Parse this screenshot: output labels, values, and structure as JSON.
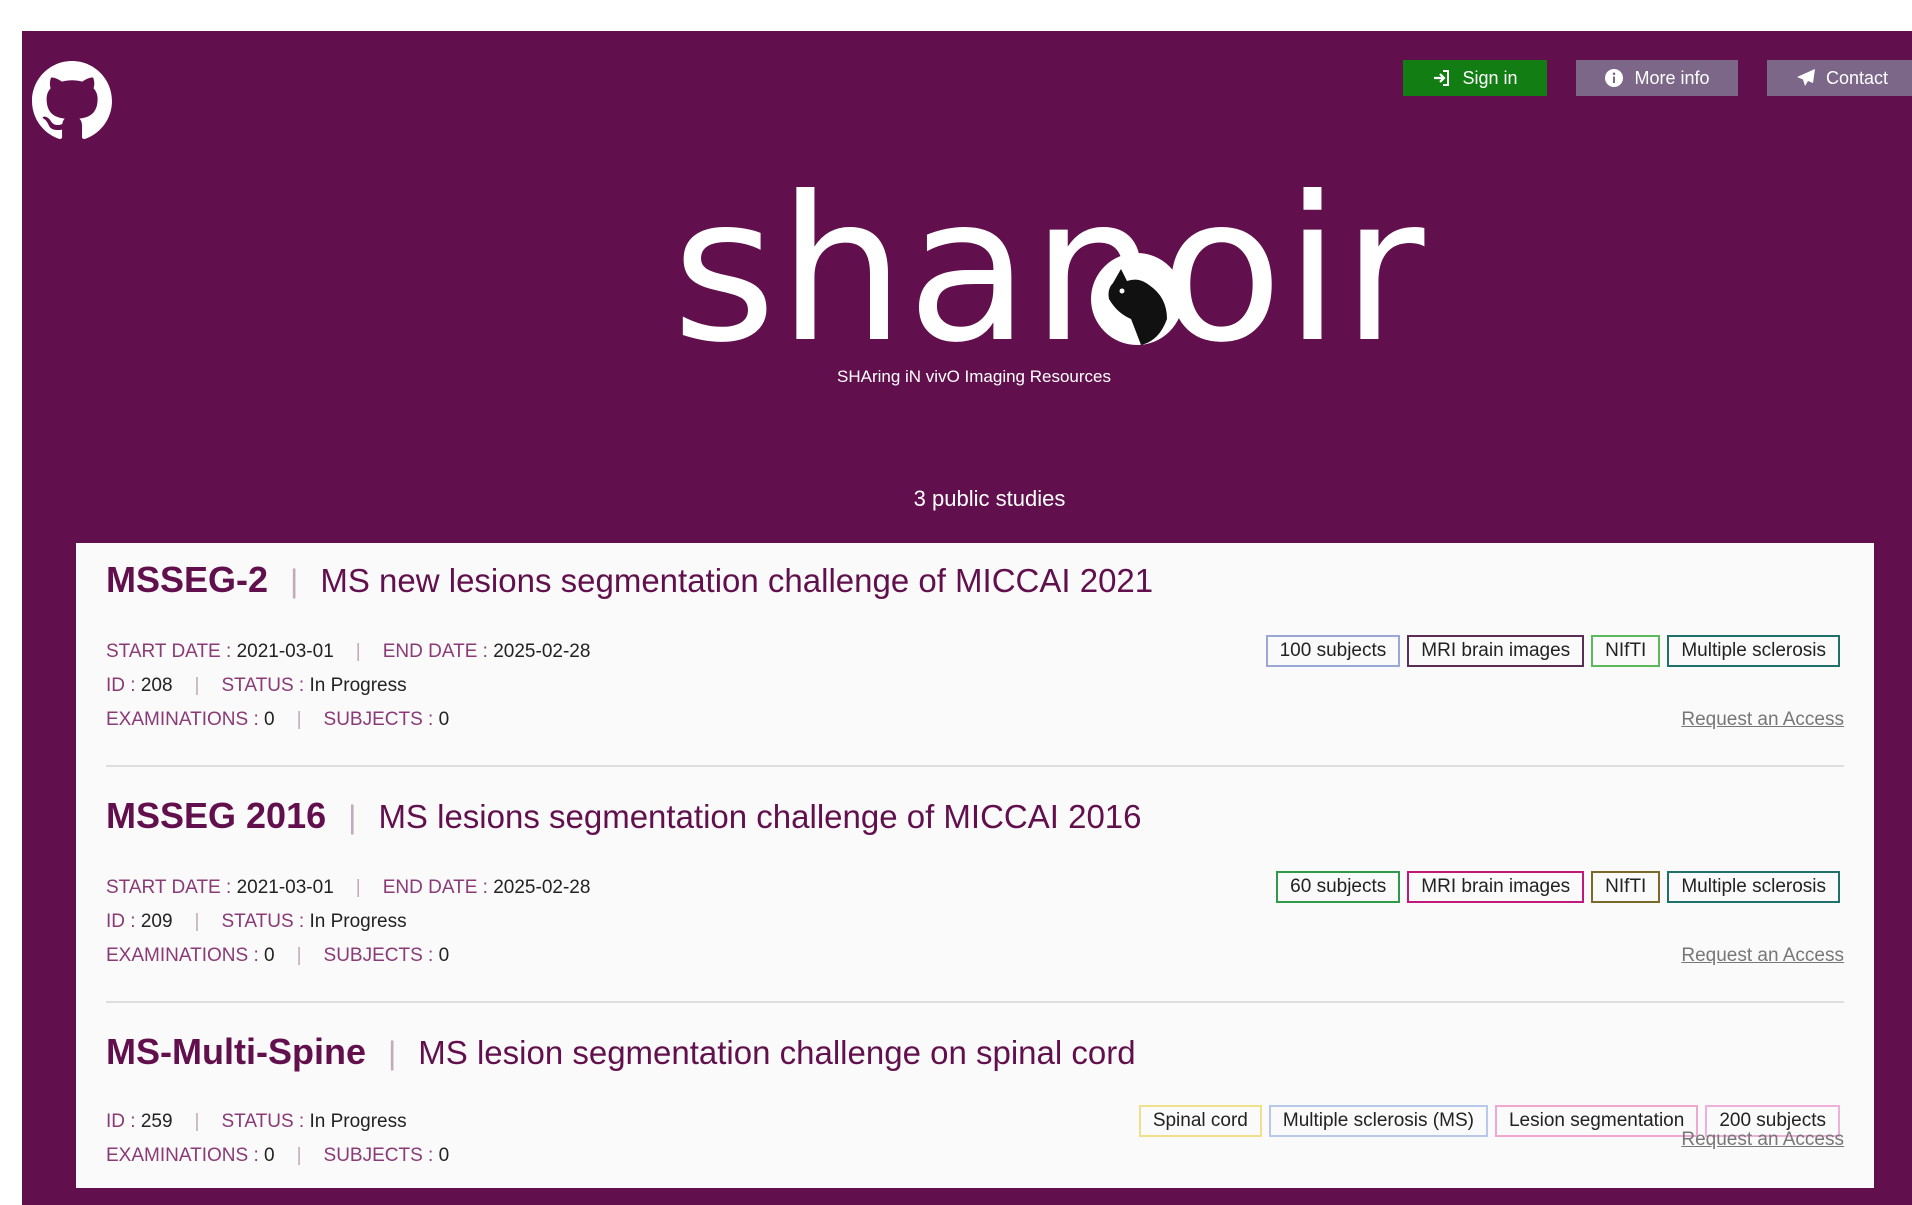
{
  "header": {
    "nav": {
      "sign_in": "Sign in",
      "more_info": "More info",
      "contact": "Contact"
    },
    "logo_text": "shanoir",
    "tagline": "SHAring iN vivO Imaging Resources",
    "study_count": "3 public studies"
  },
  "labels": {
    "start_date": "START DATE",
    "end_date": "END DATE",
    "id": "ID",
    "status": "STATUS",
    "examinations": "EXAMINATIONS",
    "subjects": "SUBJECTS",
    "request_access": "Request an Access"
  },
  "colors": {
    "brand_purple": "#62104d",
    "sign_in_green": "#117d12",
    "nav_gray": "#7c6789"
  },
  "studies": [
    {
      "code": "MSSEG-2",
      "title": "MS new lesions segmentation challenge of MICCAI 2021",
      "start_date": "2021-03-01",
      "end_date": "2025-02-28",
      "id": "208",
      "status": "In Progress",
      "examinations": "0",
      "subjects": "0",
      "tags": [
        {
          "label": "100 subjects",
          "color": "#9aa7d8"
        },
        {
          "label": "MRI brain images",
          "color": "#5a2e55"
        },
        {
          "label": "NIfTI",
          "color": "#5cb85c"
        },
        {
          "label": "Multiple sclerosis",
          "color": "#1f6f6a"
        }
      ]
    },
    {
      "code": "MSSEG 2016",
      "title": "MS lesions segmentation challenge of MICCAI 2016",
      "start_date": "2021-03-01",
      "end_date": "2025-02-28",
      "id": "209",
      "status": "In Progress",
      "examinations": "0",
      "subjects": "0",
      "tags": [
        {
          "label": "60 subjects",
          "color": "#2e9a4a"
        },
        {
          "label": "MRI brain images",
          "color": "#c2187a"
        },
        {
          "label": "NIfTI",
          "color": "#7a6a2a"
        },
        {
          "label": "Multiple sclerosis",
          "color": "#1f6f6a"
        }
      ]
    },
    {
      "code": "MS-Multi-Spine",
      "title": "MS lesion segmentation challenge on spinal cord",
      "id": "259",
      "status": "In Progress",
      "examinations": "0",
      "subjects": "0",
      "tags": [
        {
          "label": "Spinal cord",
          "color": "#f0e08c"
        },
        {
          "label": "Multiple sclerosis (MS)",
          "color": "#b8c8ea"
        },
        {
          "label": "Lesion segmentation",
          "color": "#f0a8d0"
        },
        {
          "label": "200 subjects",
          "color": "#f0b0dc"
        }
      ]
    }
  ]
}
